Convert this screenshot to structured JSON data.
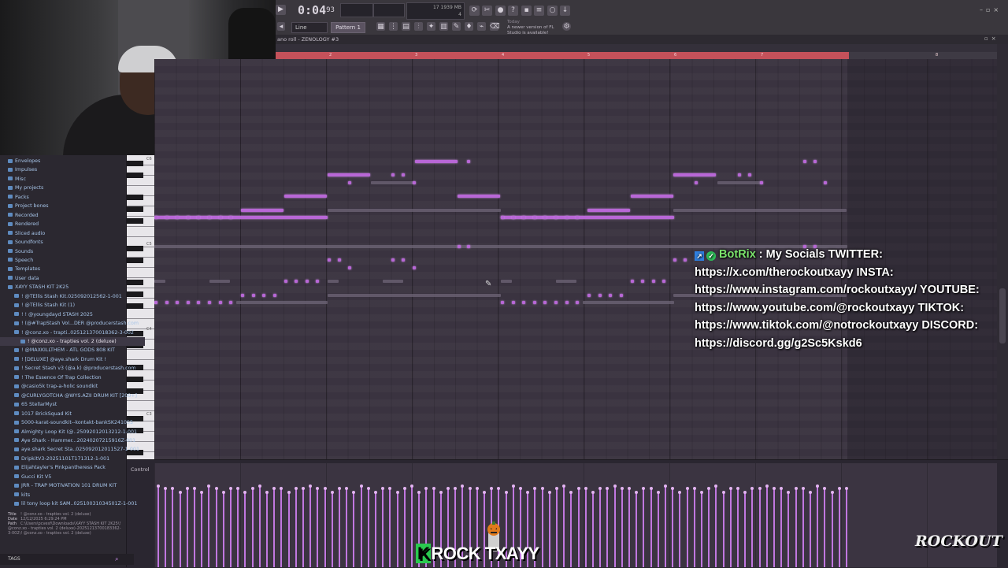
{
  "transport": {
    "time_main": "0:04",
    "time_frac": "93",
    "cpu_top": "17   1939 MB",
    "cpu_bottom": "4"
  },
  "toolbar": {
    "snap_label": "Line",
    "pattern_label": "Pattern 1",
    "news_today": "Today",
    "news_text": "A newer version of FL Studio is available!"
  },
  "piano_roll": {
    "title": "ano roll - ZENOLOGY #3",
    "ruler_numbers": [
      "2",
      "3",
      "4",
      "5",
      "6",
      "7",
      "8"
    ],
    "octave_labels": [
      "C6",
      "C5",
      "C4",
      "C3"
    ],
    "control_label": "Control"
  },
  "browser": {
    "items": [
      {
        "label": "Envelopes",
        "type": "folder"
      },
      {
        "label": "Impulses",
        "type": "folder"
      },
      {
        "label": "Misc",
        "type": "folder"
      },
      {
        "label": "My projects",
        "type": "folder"
      },
      {
        "label": "Packs",
        "type": "folder"
      },
      {
        "label": "Project bones",
        "type": "folder"
      },
      {
        "label": "Recorded",
        "type": "folder"
      },
      {
        "label": "Rendered",
        "type": "folder"
      },
      {
        "label": "Sliced audio",
        "type": "folder"
      },
      {
        "label": "Soundfonts",
        "type": "folder"
      },
      {
        "label": "Sounds",
        "type": "folder"
      },
      {
        "label": "Speech",
        "type": "folder"
      },
      {
        "label": "Templates",
        "type": "folder"
      },
      {
        "label": "User data",
        "type": "folder"
      },
      {
        "label": "XAYY STASH KIT 2K25",
        "type": "open"
      },
      {
        "label": "! @TEllis Stash Kit.025092012562-1-001",
        "type": "folder"
      },
      {
        "label": "! @TEllis Stash Kit (1)",
        "type": "folder"
      },
      {
        "label": "! ! @youngdayd STASH 2025",
        "type": "folder"
      },
      {
        "label": "! (@#TrapStash Vol...DER @producerstash.com",
        "type": "folder"
      },
      {
        "label": "! @conz.xo - trapti..025121370018362-3-002",
        "type": "folder"
      },
      {
        "label": "! @conz.xo - trapties vol. 2 (deluxe)",
        "type": "selected"
      },
      {
        "label": "! @MAXKILLTHEM - ATL GODS 808 KIT",
        "type": "folder"
      },
      {
        "label": "! [DELUXE] @aye.shark Drum Kit !",
        "type": "folder"
      },
      {
        "label": "! Secret Stash v3 (@a.k) @producerstash.com",
        "type": "folder"
      },
      {
        "label": "! The Essence Of Trap Collection",
        "type": "folder"
      },
      {
        "label": "@casio5k trap-a-holic soundkit",
        "type": "folder"
      },
      {
        "label": "@CURLYGOTCHA @WYS.AZII DRUM KIT [200+]",
        "type": "folder"
      },
      {
        "label": "65 StellarMyst",
        "type": "folder"
      },
      {
        "label": "1017 BrickSquad Kit",
        "type": "folder"
      },
      {
        "label": "5000-karat-soundkit--kontakt-bankSK241055",
        "type": "folder"
      },
      {
        "label": "Almighty Loop Kit (@..25092012013212-1-001",
        "type": "folder"
      },
      {
        "label": "Aye Shark - Hammer...20240207215916Z-001",
        "type": "folder"
      },
      {
        "label": "aye.shark Secret Sta..025092012011527-1-001",
        "type": "folder"
      },
      {
        "label": "DripkitV3-20251101T171312-1-001",
        "type": "folder"
      },
      {
        "label": "Elijahtayler's Pinkpantheress Pack",
        "type": "folder"
      },
      {
        "label": "Gucci Kit V5",
        "type": "folder"
      },
      {
        "label": "JRR - TRAP MOTIVATION 101 DRUM KIT",
        "type": "folder"
      },
      {
        "label": "kits",
        "type": "folder"
      },
      {
        "label": "lil tony loop kit SAM..02510031034501Z-1-001",
        "type": "folder"
      }
    ],
    "info_title_key": "Title",
    "info_title": "! @conz.xo - trapties vol. 2 (deluxe)",
    "info_date_key": "Date",
    "info_date": "12/12/2025 6:29:24 PM",
    "info_path_key": "Path",
    "info_path": "C:\\Users\\pcvesf\\Downloads\\XAYY STASH KIT 2K25\\! @conz.xo - trapties vol. 2 (deluxe)-20251213700183362-3-002\\! @conz.xo - trapties vol. 2 (deluxe)",
    "tags_label": "TAGS"
  },
  "chat": {
    "username": "BotRix",
    "separator": ":",
    "message_lines": [
      "My Socials TWITTER:",
      "https://x.com/therockoutxayy INSTA:",
      "https://www.instagram.com/rockoutxayy/ YOUTUBE:",
      "https://www.youtube.com/@rockoutxayy TIKTOK:",
      "https://www.tiktok.com/@notrockoutxayy DISCORD:",
      "https://discord.gg/g2Sc5Kskd6"
    ]
  },
  "overlay": {
    "logo_k": "K",
    "logo_text": "ROCK   TXAYY",
    "logo_right": "ROCKOUT"
  },
  "colors": {
    "note": "#b867d6",
    "ruler": "#c4515a",
    "chat_username": "#7be36c",
    "logo_accent": "#2ac94f"
  }
}
